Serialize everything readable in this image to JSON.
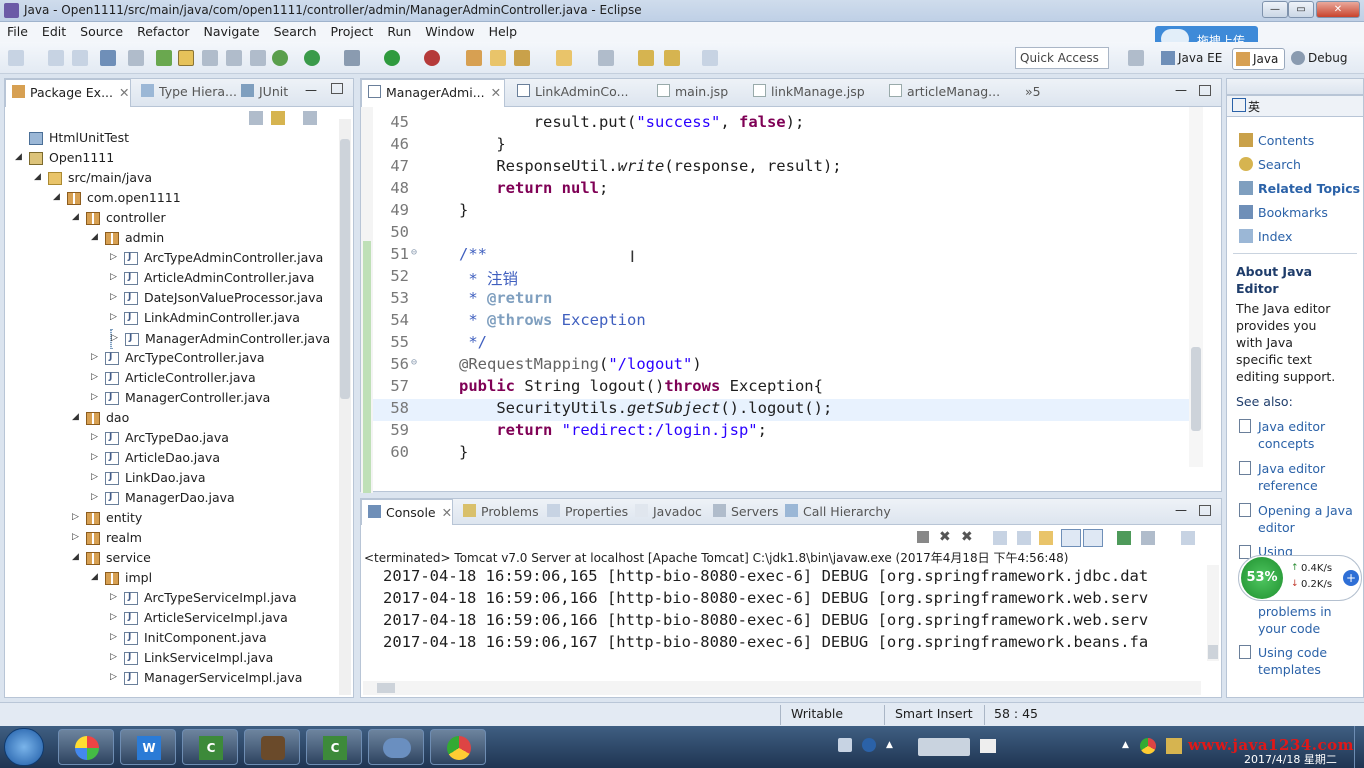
{
  "window": {
    "title": "Java - Open1111/src/main/java/com/open1111/controller/admin/ManagerAdminController.java - Eclipse"
  },
  "menu": [
    "File",
    "Edit",
    "Source",
    "Refactor",
    "Navigate",
    "Search",
    "Project",
    "Run",
    "Window",
    "Help"
  ],
  "toolbar": {
    "quick_access": "Quick Access",
    "upload_label": "拖拽上传"
  },
  "perspectives": [
    "Java EE",
    "Java",
    "Debug"
  ],
  "left_tabs": [
    "Package Ex...",
    "Type Hiera...",
    "JUnit"
  ],
  "tree": [
    {
      "label": "HtmlUnitTest",
      "type": "projg",
      "indent": 0,
      "arrow": ""
    },
    {
      "label": "Open1111",
      "type": "proj",
      "indent": 0,
      "arrow": "◢"
    },
    {
      "label": "src/main/java",
      "type": "folder",
      "indent": 1,
      "arrow": "◢"
    },
    {
      "label": "com.open1111",
      "type": "pkg",
      "indent": 2,
      "arrow": "◢"
    },
    {
      "label": "controller",
      "type": "pkg",
      "indent": 3,
      "arrow": "◢"
    },
    {
      "label": "admin",
      "type": "pkg",
      "indent": 4,
      "arrow": "◢"
    },
    {
      "label": "ArcTypeAdminController.java",
      "type": "java",
      "indent": 5,
      "arrow": "▷"
    },
    {
      "label": "ArticleAdminController.java",
      "type": "java",
      "indent": 5,
      "arrow": "▷"
    },
    {
      "label": "DateJsonValueProcessor.java",
      "type": "java",
      "indent": 5,
      "arrow": "▷"
    },
    {
      "label": "LinkAdminController.java",
      "type": "java",
      "indent": 5,
      "arrow": "▷"
    },
    {
      "label": "ManagerAdminController.java",
      "type": "java",
      "indent": 5,
      "arrow": "▷",
      "selected": true
    },
    {
      "label": "ArcTypeController.java",
      "type": "java",
      "indent": 4,
      "arrow": "▷"
    },
    {
      "label": "ArticleController.java",
      "type": "java",
      "indent": 4,
      "arrow": "▷"
    },
    {
      "label": "ManagerController.java",
      "type": "java",
      "indent": 4,
      "arrow": "▷"
    },
    {
      "label": "dao",
      "type": "pkg",
      "indent": 3,
      "arrow": "◢"
    },
    {
      "label": "ArcTypeDao.java",
      "type": "java",
      "indent": 4,
      "arrow": "▷"
    },
    {
      "label": "ArticleDao.java",
      "type": "java",
      "indent": 4,
      "arrow": "▷"
    },
    {
      "label": "LinkDao.java",
      "type": "java",
      "indent": 4,
      "arrow": "▷"
    },
    {
      "label": "ManagerDao.java",
      "type": "java",
      "indent": 4,
      "arrow": "▷"
    },
    {
      "label": "entity",
      "type": "pkg",
      "indent": 3,
      "arrow": "▷"
    },
    {
      "label": "realm",
      "type": "pkg",
      "indent": 3,
      "arrow": "▷"
    },
    {
      "label": "service",
      "type": "pkg",
      "indent": 3,
      "arrow": "◢"
    },
    {
      "label": "impl",
      "type": "pkg",
      "indent": 4,
      "arrow": "◢"
    },
    {
      "label": "ArcTypeServiceImpl.java",
      "type": "java",
      "indent": 5,
      "arrow": "▷"
    },
    {
      "label": "ArticleServiceImpl.java",
      "type": "java",
      "indent": 5,
      "arrow": "▷"
    },
    {
      "label": "InitComponent.java",
      "type": "java",
      "indent": 5,
      "arrow": "▷"
    },
    {
      "label": "LinkServiceImpl.java",
      "type": "java",
      "indent": 5,
      "arrow": "▷"
    },
    {
      "label": "ManagerServiceImpl.java",
      "type": "java",
      "indent": 5,
      "arrow": "▷"
    }
  ],
  "editor_tabs": [
    "ManagerAdmi...",
    "LinkAdminCo...",
    "main.jsp",
    "linkManage.jsp",
    "articleManag...",
    "»5"
  ],
  "editor_lines": [
    {
      "n": "45",
      "html": "        result.put(<span class=\"str\">\"success\"</span>, <span class=\"kw\">false</span>);"
    },
    {
      "n": "46",
      "html": "    }"
    },
    {
      "n": "47",
      "html": "    ResponseUtil.<span class=\"it\">write</span>(response, result);"
    },
    {
      "n": "48",
      "html": "    <span class=\"kw\">return null</span>;"
    },
    {
      "n": "49",
      "html": "}"
    },
    {
      "n": "50",
      "html": ""
    },
    {
      "n": "51",
      "html": "<span class=\"cm\">/**</span>"
    },
    {
      "n": "52",
      "html": "<span class=\"cm\"> * 注销</span>"
    },
    {
      "n": "53",
      "html": "<span class=\"cm\"> * </span><span class=\"tag\">@return</span>"
    },
    {
      "n": "54",
      "html": "<span class=\"cm\"> * </span><span class=\"tag\">@throws</span><span class=\"cm\"> Exception</span>"
    },
    {
      "n": "55",
      "html": "<span class=\"cm\"> */</span>"
    },
    {
      "n": "56",
      "html": "<span class=\"an\">@RequestMapping</span>(<span class=\"str\">\"/logout\"</span>)"
    },
    {
      "n": "57",
      "html": "<span class=\"kw\">public</span> String logout()<span class=\"kw\">throws</span> Exception{"
    },
    {
      "n": "58",
      "html": "    SecurityUtils.<span class=\"it\">getSubject</span>().logout();"
    },
    {
      "n": "59",
      "html": "    <span class=\"kw\">return</span> <span class=\"str\">\"redirect:/login.jsp\"</span>;"
    },
    {
      "n": "60",
      "html": "}"
    }
  ],
  "bottom_tabs": [
    "Console",
    "Problems",
    "Properties",
    "Javadoc",
    "Servers",
    "Call Hierarchy"
  ],
  "console": {
    "header": "<terminated> Tomcat v7.0 Server at localhost [Apache Tomcat] C:\\jdk1.8\\bin\\javaw.exe (2017年4月18日 下午4:56:48)",
    "lines": [
      "2017-04-18 16:59:06,165 [http-bio-8080-exec-6] DEBUG [org.springframework.jdbc.dat",
      "2017-04-18 16:59:06,166 [http-bio-8080-exec-6] DEBUG [org.springframework.web.serv",
      "2017-04-18 16:59:06,166 [http-bio-8080-exec-6] DEBUG [org.springframework.web.serv",
      "2017-04-18 16:59:06,167 [http-bio-8080-exec-6] DEBUG [org.springframework.beans.fa"
    ]
  },
  "help": {
    "links": [
      "Contents",
      "Search",
      "Related Topics",
      "Bookmarks",
      "Index"
    ],
    "about_title": "About Java Editor",
    "about_text": "The Java editor provides you with Java specific text editing support.",
    "see_also": "See also:",
    "see_links": [
      "Java editor concepts",
      "Java editor reference",
      "Opening a Java editor",
      "Using",
      "problems in your code",
      "Using code templates"
    ]
  },
  "net_widget": {
    "percent": "53%",
    "up": "0.4K/s",
    "down": "0.2K/s"
  },
  "status": {
    "writable": "Writable",
    "insert": "Smart Insert",
    "position": "58 : 45"
  },
  "tray": {
    "watermark": "www.java1234.com",
    "date": "2017/4/18 星期二",
    "lang": "英"
  }
}
